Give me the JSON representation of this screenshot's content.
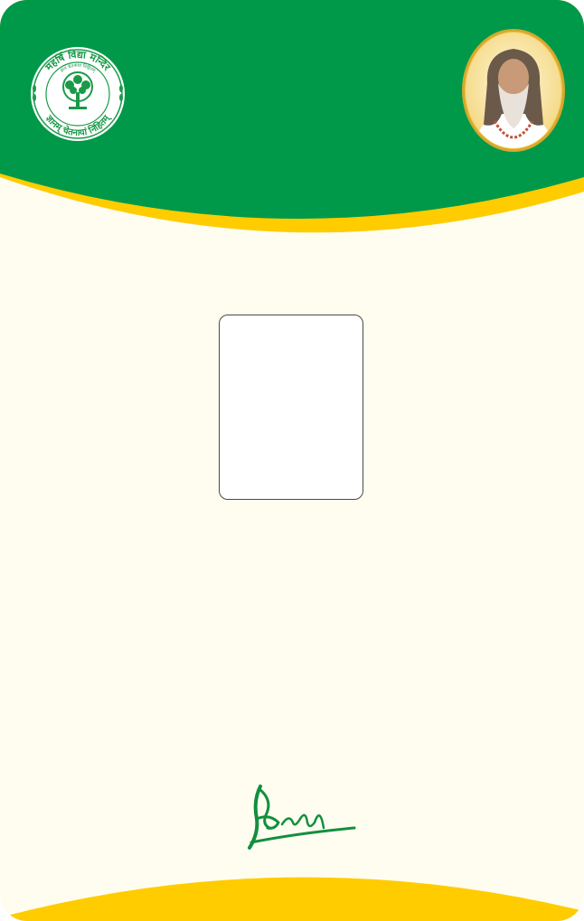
{
  "card": {
    "colors": {
      "header_green": "#00994a",
      "accent_yellow": "#ffcc00",
      "body_cream": "#fefdf0",
      "seal_green": "#1a9a48",
      "signature_green": "#128f3e"
    },
    "logo": {
      "icon": "school-seal-tree-icon",
      "top_text": "महर्षि विद्या मन्दिर",
      "inner_text": "ज्ञानं चेतनायां निहितम्",
      "bottom_text": "ज्ञानम् चेतनायां निहितम्"
    },
    "portrait": {
      "icon": "founder-portrait-icon"
    },
    "photo_placeholder": {
      "icon": "blank-photo-box"
    },
    "signature": {
      "icon": "authorized-signature-icon"
    }
  }
}
